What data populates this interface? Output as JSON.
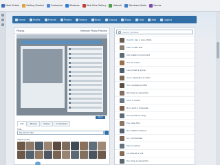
{
  "bookmarks": [
    {
      "label": "Most Visited",
      "color": "#3b6fb6"
    },
    {
      "label": "Getting Started",
      "color": "#e2a13b"
    },
    {
      "label": "Customize",
      "color": "#4b8bd6"
    },
    {
      "label": "Windows",
      "color": "#2c7dd2"
    },
    {
      "label": "Web Slice Gallery",
      "color": "#c23b3b"
    },
    {
      "label": "Hotmail",
      "color": "#4a9f4a"
    },
    {
      "label": "Windows Media",
      "color": "#3f7ec9"
    },
    {
      "label": "Games",
      "color": "#7a4ab0"
    }
  ],
  "nav": [
    "Home",
    "Profile",
    "Friends",
    "Photos",
    "Videos",
    "Music",
    "Groups",
    "Blogs",
    "Chat",
    "Mail",
    "Logout"
  ],
  "left_panel": {
    "title": "Photos",
    "subtitle": "Member Photo Preview",
    "badge": "Next",
    "tabs": [
      "Info",
      "Photos",
      "Videos",
      "Comments"
    ],
    "field_label": "Title",
    "field_value": "My photo title",
    "visitors_label": "Visitors (40)"
  },
  "right_panel": {
    "search_placeholder": "Search updates",
    "items": [
      {
        "name": "User01",
        "msg": "has a new photo",
        "color": "#6b5a4e"
      },
      {
        "name": "Marco",
        "msg": "likes this",
        "color": "#8a7f72"
      },
      {
        "name": "Kat",
        "msg": "posted a comment",
        "color": "#5e6c7a"
      },
      {
        "name": "Zoe",
        "msg": "is online",
        "color": "#9a6f4f"
      },
      {
        "name": "Lee",
        "msg": "joined a group",
        "color": "#4f5e6b"
      },
      {
        "name": "Anna",
        "msg": "uploaded a video",
        "color": "#7b6a55"
      },
      {
        "name": "Tom",
        "msg": "updated profile",
        "color": "#5a4f45"
      },
      {
        "name": "Rita",
        "msg": "has a new photo",
        "color": "#846f61"
      },
      {
        "name": "Sam",
        "msg": "is online",
        "color": "#6a7884"
      },
      {
        "name": "Nina",
        "msg": "sent a message",
        "color": "#7d5f4c"
      },
      {
        "name": "Paul",
        "msg": "posted a blog",
        "color": "#5d6b76"
      },
      {
        "name": "Eve",
        "msg": "likes this",
        "color": "#8b7563"
      },
      {
        "name": "Ben",
        "msg": "added a friend",
        "color": "#56626d"
      },
      {
        "name": "Ivy",
        "msg": "commented",
        "color": "#7c6656"
      },
      {
        "name": "Max",
        "msg": "is online",
        "color": "#647381"
      },
      {
        "name": "Liz",
        "msg": "shared a link",
        "color": "#866d5b"
      },
      {
        "name": "Dan",
        "msg": "has a new photo",
        "color": "#5b6670"
      }
    ]
  },
  "avatar_colors": [
    "#6d5847",
    "#8d7a68",
    "#4e5a65",
    "#9b8470",
    "#5a4a3f",
    "#7f6c5c",
    "#3f4b55",
    "#8a6f5b",
    "#5f6e7a",
    "#a08a75",
    "#6a5848",
    "#55636f",
    "#8f7864",
    "#4d5863",
    "#7a6552",
    "#9a8572",
    "#5c6975",
    "#83705e",
    "#4a5560",
    "#6e5b4b"
  ]
}
